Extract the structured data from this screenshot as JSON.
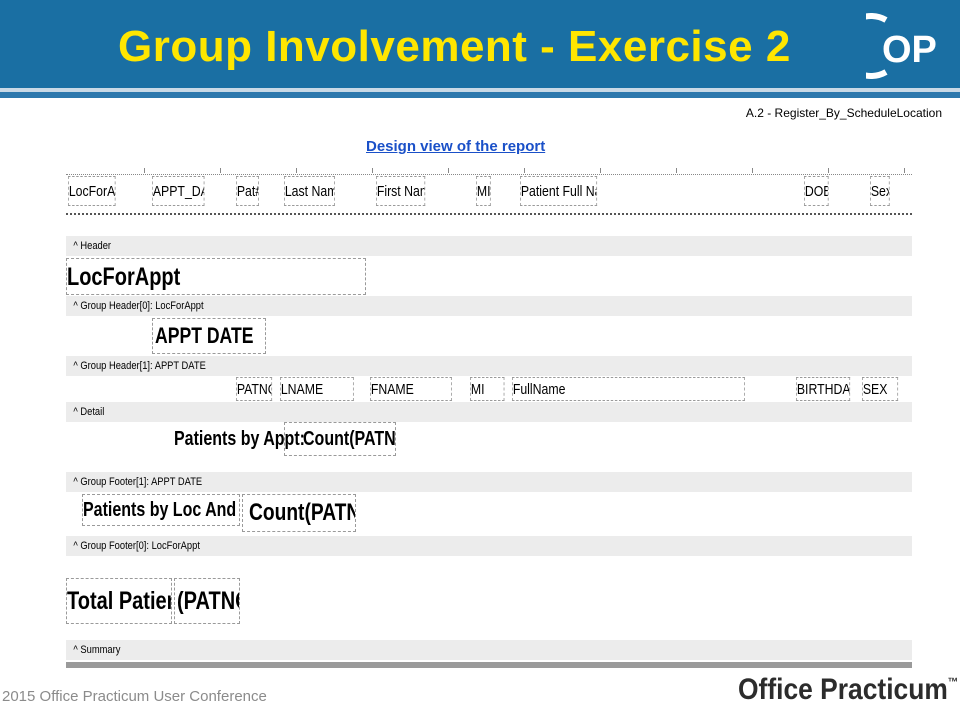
{
  "slide": {
    "title": "Group Involvement - Exercise 2",
    "subtitle": "A.2 - Register_By_ScheduleLocation",
    "design_link": "Design view of the report",
    "footer_left": "2015 Office Practicum User Conference",
    "footer_brand": "Office Practicum",
    "footer_brand_tm": "™",
    "logo_text": "OP"
  },
  "report": {
    "page_header_fields": [
      "LocForAppt",
      "APPT_DATE",
      "Pat#",
      "Last Name",
      "First Name",
      "MI",
      "Patient Full Name",
      "DOB",
      "Sex"
    ],
    "bands": {
      "header": "^  Header",
      "group_header_0": "^  Group Header[0]: LocForAppt",
      "group_header_1": "^  Group Header[1]: APPT DATE",
      "detail": "^  Detail",
      "group_footer_1": "^  Group Footer[1]: APPT DATE",
      "group_footer_0": "^  Group Footer[0]: LocForAppt",
      "summary": "^  Summary"
    },
    "header_field": "LocForAppt",
    "group0_field": "APPT DATE",
    "detail_fields": [
      "PATNO",
      "LNAME",
      "FNAME",
      "MI",
      "FullName",
      "BIRTHDAT",
      "SEX"
    ],
    "footer1_label": "Patients by Appt:",
    "footer1_value": "Count(PATNO)",
    "footer0_label": "Patients by Loc And Appt:",
    "footer0_value": "Count(PATNO)",
    "summary_label": "Total Patients:",
    "summary_value": "(PATNO)"
  },
  "colors": {
    "header_blue": "#1a6fa3",
    "title_yellow": "#ffe600",
    "link_blue": "#1a50c8",
    "band_gray": "#ececec"
  }
}
